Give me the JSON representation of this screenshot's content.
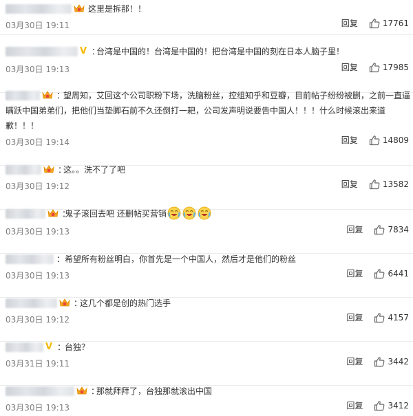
{
  "comments": [
    {
      "text": "这里是拆那！！",
      "date": "03月30日",
      "time": "19:11",
      "reply": "回复",
      "likes": "17761",
      "badge": "crown",
      "emoji_count": 0
    },
    {
      "text": "台湾是中国的！台湾是中国的！把台湾是中国的刻在日本人脑子里！",
      "date": "03月30日",
      "time": "19:13",
      "reply": "回复",
      "likes": "17985",
      "badge": "v",
      "emoji_count": 0
    },
    {
      "text": "望周知，艾回这个公司职粉下场，洗脑粉丝，控组知乎和豆瓣，目前帖子纷纷被删，之前一直逼瞒跃中国弟弟们，把他们当垫脚石前不久还倒打一耙，公司发声明说要告中国人！！！什么时候滚出来道歉！！！",
      "date": "03月30日",
      "time": "19:14",
      "reply": "回复",
      "likes": "14809",
      "badge": "crown",
      "emoji_count": 0
    },
    {
      "text": "这。。洗不了了吧",
      "date": "03月30日",
      "time": "19:12",
      "reply": "回复",
      "likes": "13582",
      "badge": "crown",
      "emoji_count": 0
    },
    {
      "text": "鬼子滚回去吧 还删帖买营销",
      "date": "03月30日",
      "time": "19:13",
      "reply": "回复",
      "likes": "7834",
      "badge": "crown",
      "emoji_count": 3
    },
    {
      "text": "希望所有粉丝明白，你首先是一个中国人，然后才是他们的粉丝",
      "date": "03月30日",
      "time": "19:13",
      "reply": "回复",
      "likes": "6441",
      "badge": "none",
      "emoji_count": 0
    },
    {
      "text": "这几个都是创的热门选手",
      "date": "03月30日",
      "time": "19:12",
      "reply": "回复",
      "likes": "4157",
      "badge": "crown",
      "emoji_count": 0
    },
    {
      "text": "台独？",
      "date": "03月31日",
      "time": "19:11",
      "reply": "回复",
      "likes": "3442",
      "badge": "v",
      "emoji_count": 0
    },
    {
      "text": "那就拜拜了，台独那就滚出中国",
      "date": "03月30日",
      "time": "19:13",
      "reply": "回复",
      "likes": "3412",
      "badge": "crown",
      "emoji_count": 0
    }
  ],
  "colors": {
    "crown_badge": "#f5a623",
    "v_badge": "#f5b800",
    "emoji_face": "#fcd34d"
  },
  "icons": {
    "like": "thumbs-up-icon",
    "crown": "crown-badge-icon",
    "v": "verified-v-icon",
    "emoji": "crying-laughing-emoji-icon"
  }
}
